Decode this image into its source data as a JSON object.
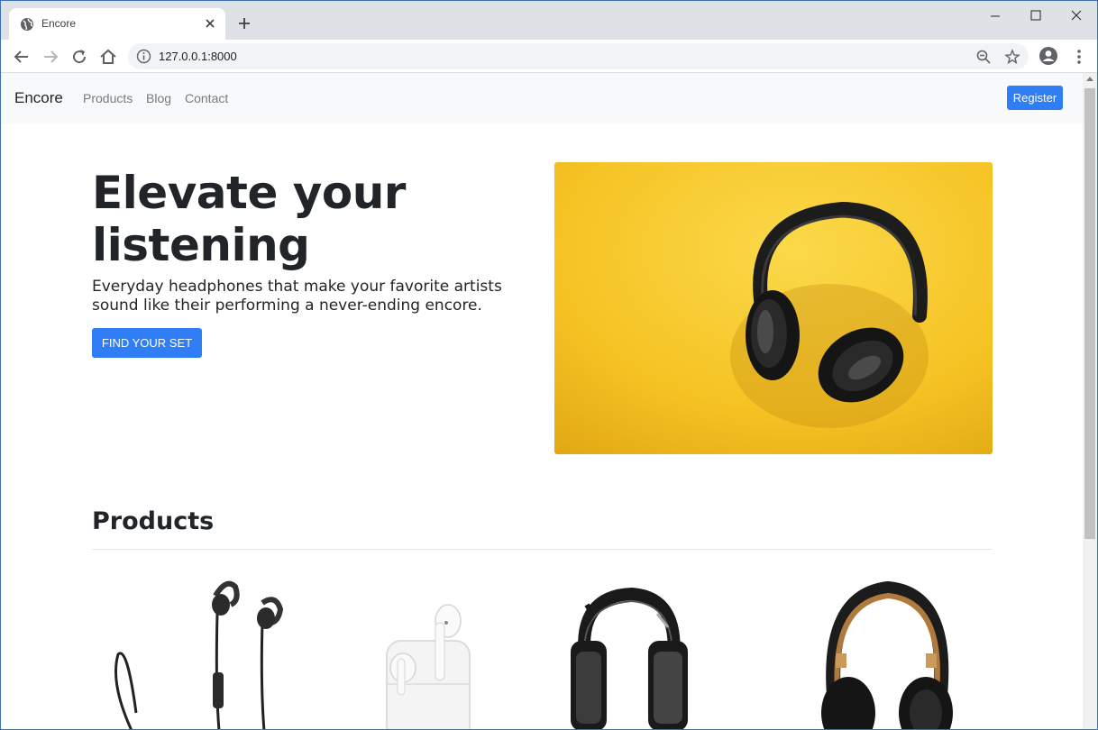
{
  "browser": {
    "tab_title": "Encore",
    "url": "127.0.0.1:8000",
    "icons": [
      "globe-icon",
      "close-icon",
      "plus-icon",
      "back-icon",
      "forward-icon",
      "reload-icon",
      "home-icon",
      "info-icon",
      "zoom-icon",
      "star-icon",
      "profile-icon",
      "more-icon"
    ]
  },
  "navbar": {
    "brand": "Encore",
    "links": [
      "Products",
      "Blog",
      "Contact"
    ],
    "register_label": "Register"
  },
  "hero": {
    "title": "Elevate your listening",
    "subtitle": "Everyday headphones that make your favorite artists sound like their performing a never-ending encore.",
    "cta_label": "FIND YOUR SET",
    "image_subject": "black over-ear headphones on a yellow background"
  },
  "products_section": {
    "title": "Products",
    "items": [
      {
        "image_subject": "wireless sport earbuds"
      },
      {
        "image_subject": "wireless earbuds with charging case"
      },
      {
        "image_subject": "gaming headset"
      },
      {
        "image_subject": "black and gold over-ear headphones"
      }
    ]
  },
  "colors": {
    "primary": "#2f7ef6",
    "navbar_bg": "#f8f9fa",
    "hero_yellow": "#f6c324",
    "text": "#212529"
  }
}
